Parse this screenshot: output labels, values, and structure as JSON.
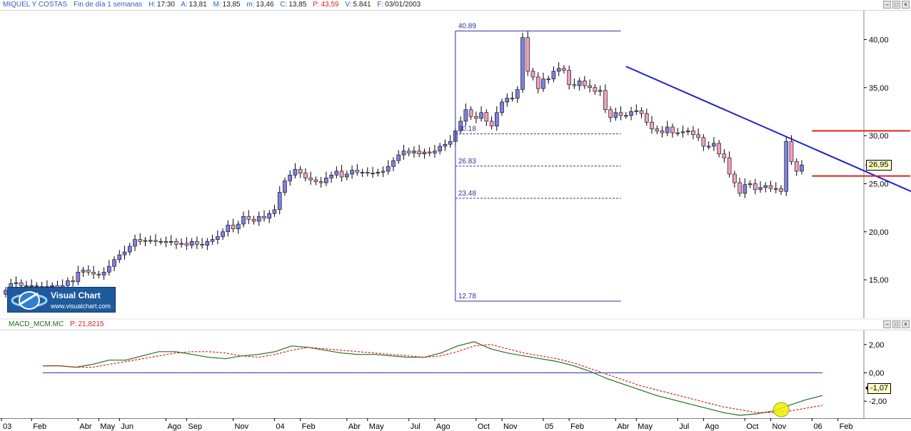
{
  "main_title": {
    "symbol": "MIQUEL Y COSTAS",
    "period": "Fin de día 1 semanas",
    "h_label": "H:",
    "h_value": "17:30",
    "a_label": "A:",
    "a_value": "13,81",
    "m_label": "M:",
    "m_value": "13,85",
    "min_label": "m:",
    "min_value": "13,46",
    "c_label": "C:",
    "c_value": "13,85",
    "p_label": "P:",
    "p_value": "43,59",
    "v_label": "V:",
    "v_value": "5.841",
    "f_label": "F:",
    "f_value": "03/01/2003"
  },
  "macd_title": {
    "name": "MACD_MCM.MC",
    "p_label": "P:",
    "p_value": "21,8215"
  },
  "logo": {
    "brand": "Visual Chart",
    "url": "www.visualchart.com"
  },
  "price_tag": "26,95",
  "macd_tag": "-1,07",
  "window_controls": [
    "–",
    "□",
    "×"
  ],
  "colors": {
    "bull": "#8080e0",
    "bear": "#f0a0c0",
    "fib": "#3030a0",
    "trend": "#2020d0",
    "resistance": "#e02020",
    "macd": "#207020",
    "signal": "#e02020",
    "zero": "#3030c0"
  },
  "chart_data": [
    {
      "type": "candlestick",
      "y_ticks": [
        "40,00",
        "35,00",
        "30,00",
        "25,00",
        "20,00",
        "15,00"
      ],
      "ylim": [
        11.0,
        43.0
      ],
      "x_ticks": [
        {
          "label": "03",
          "week": 0
        },
        {
          "label": "Feb",
          "week": 5
        },
        {
          "label": "Abr",
          "week": 14
        },
        {
          "label": "May",
          "week": 18
        },
        {
          "label": "Jun",
          "week": 22
        },
        {
          "label": "Ago",
          "week": 31
        },
        {
          "label": "Sep",
          "week": 35
        },
        {
          "label": "Nov",
          "week": 44
        },
        {
          "label": "04",
          "week": 52
        },
        {
          "label": "Feb",
          "week": 57
        },
        {
          "label": "Abr",
          "week": 66
        },
        {
          "label": "May",
          "week": 70
        },
        {
          "label": "Jul",
          "week": 78
        },
        {
          "label": "Ago",
          "week": 83
        },
        {
          "label": "Oct",
          "week": 91
        },
        {
          "label": "Nov",
          "week": 96
        },
        {
          "label": "05",
          "week": 104
        },
        {
          "label": "Feb",
          "week": 109
        },
        {
          "label": "Abr",
          "week": 118
        },
        {
          "label": "May",
          "week": 122
        },
        {
          "label": "Jul",
          "week": 130
        },
        {
          "label": "Ago",
          "week": 135
        },
        {
          "label": "Oct",
          "week": 143
        },
        {
          "label": "Nov",
          "week": 148
        },
        {
          "label": "06",
          "week": 156
        },
        {
          "label": "Feb",
          "week": 161
        }
      ],
      "weeks_total": 166,
      "closes": [
        13.9,
        14.6,
        14.7,
        14.4,
        14.3,
        14.4,
        14.3,
        14.2,
        14.3,
        14.4,
        14.2,
        14.4,
        14.9,
        14.8,
        15.8,
        16.0,
        15.8,
        15.6,
        15.5,
        15.8,
        16.4,
        17.1,
        17.6,
        17.9,
        18.5,
        19.2,
        19.0,
        19.1,
        19.1,
        19.0,
        19.0,
        18.9,
        19.0,
        18.7,
        18.8,
        18.6,
        19.0,
        18.7,
        18.6,
        19.0,
        19.2,
        19.5,
        20.0,
        20.7,
        20.3,
        20.8,
        21.6,
        21.3,
        21.1,
        21.6,
        21.4,
        21.9,
        22.3,
        24.1,
        25.3,
        25.9,
        26.5,
        26.1,
        25.6,
        25.4,
        25.2,
        25.1,
        25.6,
        25.9,
        26.3,
        25.7,
        26.0,
        26.4,
        26.2,
        26.2,
        26.1,
        26.1,
        26.2,
        26.3,
        26.8,
        27.4,
        28.0,
        28.4,
        28.2,
        28.4,
        28.1,
        28.3,
        28.2,
        28.4,
        28.9,
        29.1,
        29.4,
        30.5,
        31.5,
        32.7,
        32.0,
        31.8,
        32.4,
        31.5,
        31.0,
        32.4,
        33.5,
        33.9,
        33.9,
        34.8,
        40.2,
        36.7,
        36.1,
        34.9,
        35.9,
        35.9,
        36.7,
        37.0,
        36.8,
        35.3,
        35.2,
        35.7,
        35.2,
        35.0,
        34.6,
        34.7,
        32.7,
        31.9,
        32.4,
        32.1,
        32.1,
        32.5,
        32.6,
        32.3,
        31.4,
        30.7,
        30.5,
        30.3,
        30.9,
        30.3,
        30.3,
        30.4,
        30.5,
        30.1,
        29.8,
        28.9,
        28.9,
        29.2,
        28.1,
        27.7,
        26.0,
        25.1,
        24.0,
        24.9,
        25.0,
        24.4,
        24.6,
        24.8,
        24.5,
        24.5,
        24.2,
        29.4,
        27.3,
        26.3,
        26.95
      ],
      "fibonacci": [
        {
          "label": "40.89",
          "value": 40.89,
          "style": "solid"
        },
        {
          "label": "30.18",
          "value": 30.18,
          "style": "dashed"
        },
        {
          "label": "26.83",
          "value": 26.83,
          "style": "dashed"
        },
        {
          "label": "23.48",
          "value": 23.48,
          "style": "dashed"
        },
        {
          "label": "12.78",
          "value": 12.78,
          "style": "solid"
        }
      ],
      "fib_weeks": [
        87,
        119
      ],
      "trendline": {
        "from": {
          "week": 120,
          "value": 37.2
        },
        "to": {
          "week": 176,
          "value": 24.0
        }
      },
      "resistance_lines": [
        {
          "value": 30.5,
          "from_week": 156,
          "to_week": 175
        },
        {
          "value": 25.8,
          "from_week": 156,
          "to_week": 175
        }
      ],
      "last_value": 26.95
    },
    {
      "type": "line",
      "y_ticks": [
        "2,00",
        "0,00",
        "-2,00"
      ],
      "ylim": [
        -3.2,
        3.0
      ],
      "zero_line": 0.0,
      "series": [
        {
          "kind": "macd",
          "values": [
            0.5,
            0.5,
            0.4,
            0.6,
            0.9,
            0.9,
            1.2,
            1.5,
            1.5,
            1.3,
            1.1,
            1.0,
            1.2,
            1.3,
            1.5,
            1.9,
            1.8,
            1.6,
            1.4,
            1.3,
            1.3,
            1.2,
            1.1,
            1.1,
            1.4,
            1.9,
            2.2,
            1.7,
            1.4,
            1.2,
            1.0,
            0.8,
            0.5,
            0.1,
            -0.4,
            -0.8,
            -1.2,
            -1.6,
            -1.9,
            -2.2,
            -2.5,
            -2.8,
            -3.0,
            -2.9,
            -2.7,
            -2.3,
            -1.9,
            -1.6
          ]
        },
        {
          "kind": "signal",
          "values": [
            0.5,
            0.5,
            0.4,
            0.4,
            0.6,
            0.8,
            1.0,
            1.2,
            1.4,
            1.5,
            1.5,
            1.4,
            1.2,
            1.1,
            1.3,
            1.6,
            1.8,
            1.7,
            1.6,
            1.5,
            1.4,
            1.3,
            1.2,
            1.1,
            1.2,
            1.5,
            1.9,
            2.0,
            1.7,
            1.4,
            1.2,
            1.0,
            0.7,
            0.3,
            -0.1,
            -0.5,
            -0.9,
            -1.2,
            -1.5,
            -1.8,
            -2.1,
            -2.4,
            -2.6,
            -2.8,
            -2.8,
            -2.7,
            -2.5,
            -2.3
          ]
        }
      ]
    }
  ]
}
